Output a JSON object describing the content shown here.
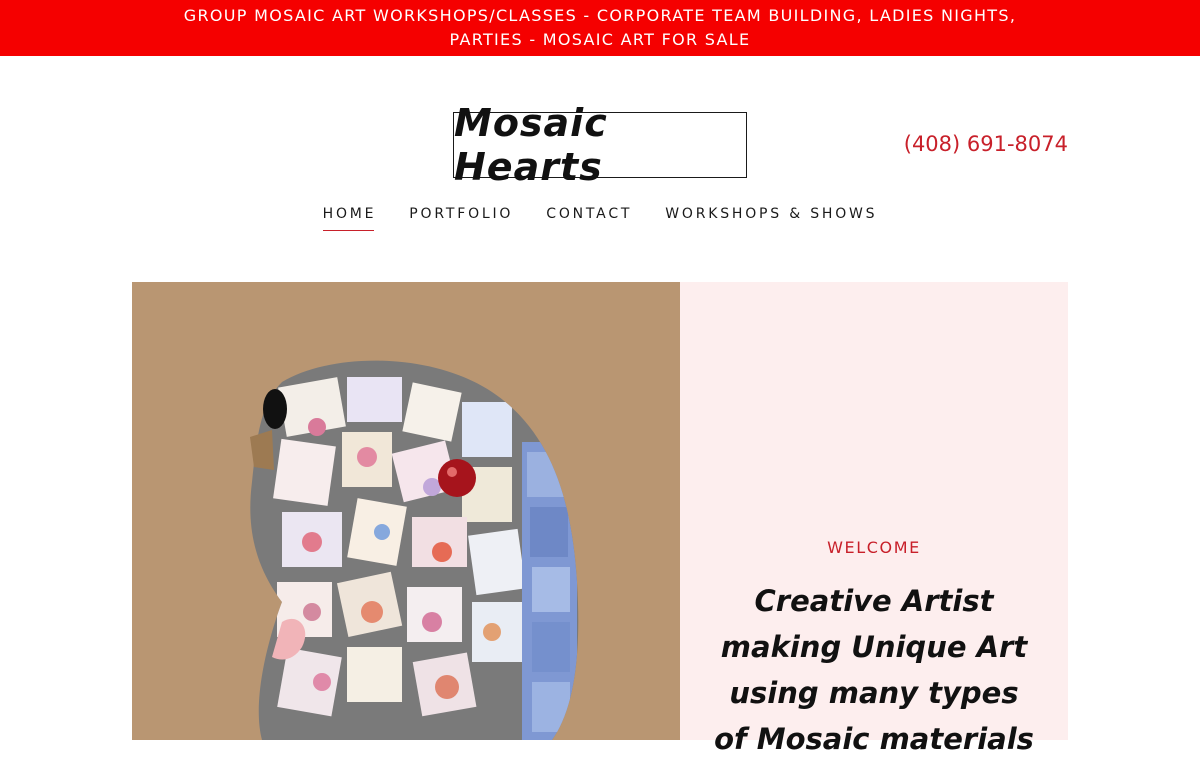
{
  "banner": {
    "line1": "GROUP MOSAIC ART WORKSHOPS/CLASSES - CORPORATE TEAM BUILDING, LADIES NIGHTS,",
    "line2": "PARTIES - MOSAIC ART FOR SALE"
  },
  "header": {
    "logo": "Mosaic Hearts",
    "phone": "(408) 691-8074"
  },
  "nav": {
    "items": [
      {
        "label": "HOME",
        "active": true
      },
      {
        "label": "PORTFOLIO"
      },
      {
        "label": "CONTACT"
      },
      {
        "label": "WORKSHOPS & SHOWS"
      }
    ]
  },
  "hero": {
    "welcome": "WELCOME",
    "headline": "Creative Artist making Unique Art using many types of Mosaic materials"
  },
  "colors": {
    "banner_bg": "#f50000",
    "accent": "#c8202a",
    "panel_bg": "#fdeeee",
    "image_bg": "#b99672"
  }
}
